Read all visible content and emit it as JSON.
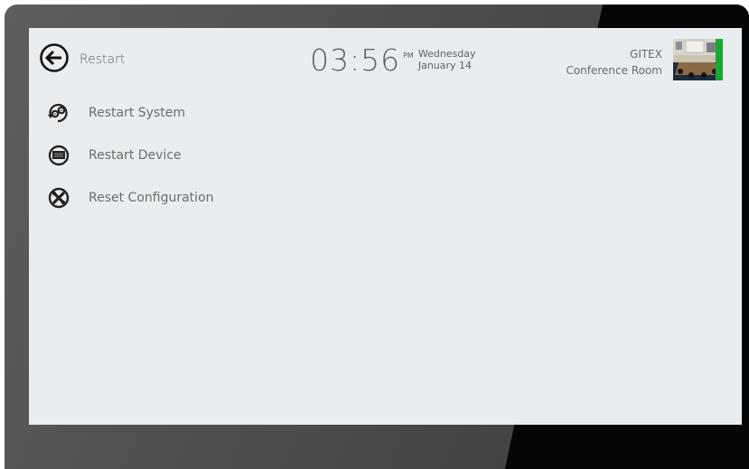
{
  "header": {
    "back_icon": "back-arrow-circle-icon",
    "title": "Restart",
    "clock": {
      "time": "03:56",
      "ampm": "PM",
      "weekday": "Wednesday",
      "date": "January 14"
    },
    "room": {
      "line1": "GITEX",
      "line2": "Conference Room",
      "status_color": "#1aa833"
    }
  },
  "menu": {
    "items": [
      {
        "label": "Restart System",
        "icon": "gears-restart-icon"
      },
      {
        "label": "Restart Device",
        "icon": "monitor-restart-icon"
      },
      {
        "label": "Reset Configuration",
        "icon": "tools-reset-icon"
      }
    ]
  },
  "colors": {
    "screen_bg": "#e9edf0",
    "text": "#6c6c6c",
    "status_green": "#1aa833"
  }
}
